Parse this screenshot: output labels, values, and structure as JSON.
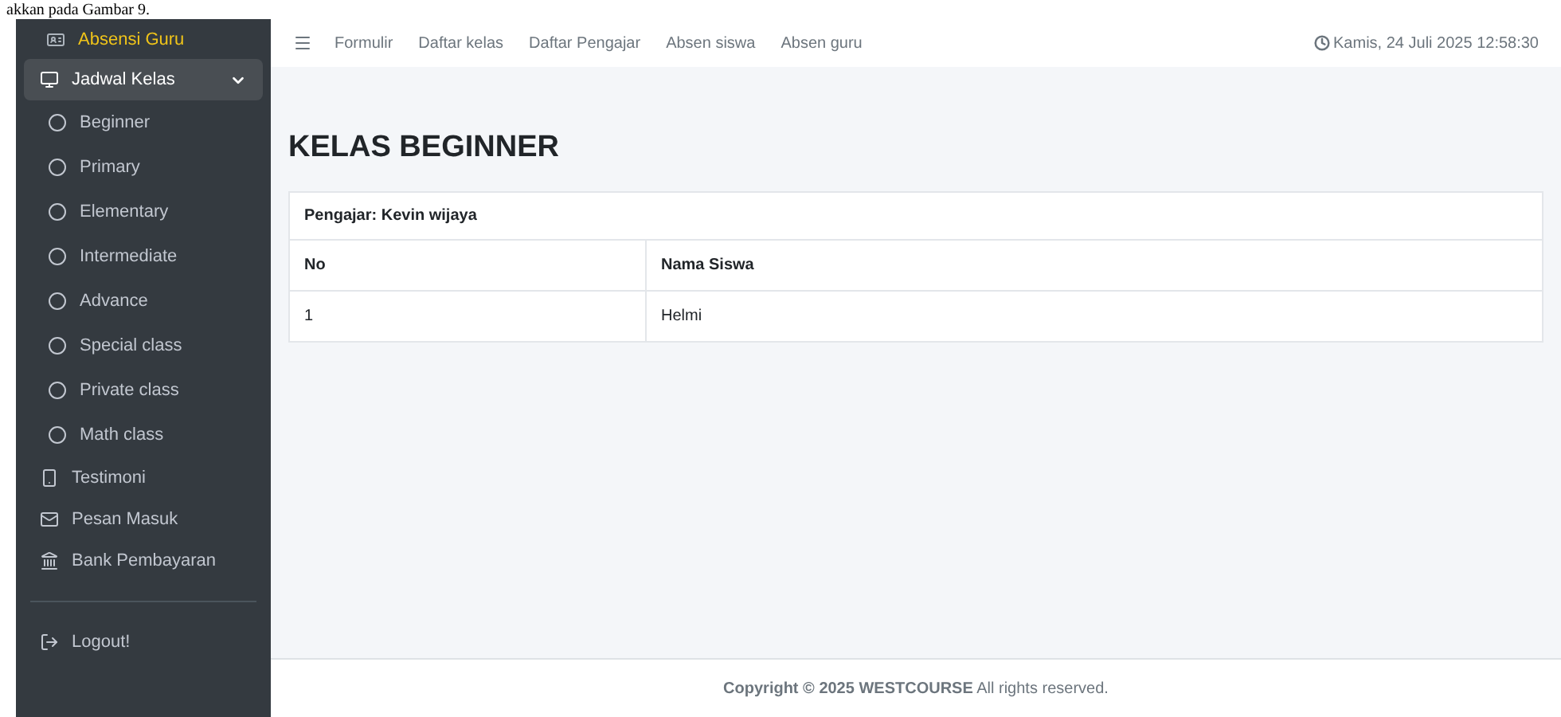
{
  "document_caption": "akkan pada Gambar 9.",
  "sidebar": {
    "brand": "Absensi Guru",
    "items": [
      {
        "kind": "menu",
        "label": "Jadwal Kelas",
        "selected": true,
        "expanded": true,
        "children": [
          {
            "label": "Beginner"
          },
          {
            "label": "Primary"
          },
          {
            "label": "Elementary"
          },
          {
            "label": "Intermediate"
          },
          {
            "label": "Advance"
          },
          {
            "label": "Special class"
          },
          {
            "label": "Private class"
          },
          {
            "label": "Math class"
          }
        ]
      },
      {
        "kind": "link",
        "label": "Testimoni",
        "selected": false
      },
      {
        "kind": "link",
        "label": "Pesan Masuk",
        "selected": false
      },
      {
        "kind": "link",
        "label": "Bank Pembayaran",
        "selected": false
      },
      {
        "kind": "divider"
      },
      {
        "kind": "link",
        "label": "Logout!",
        "selected": false
      }
    ]
  },
  "navbar": {
    "links": [
      "Formulir",
      "Daftar kelas",
      "Daftar Pengajar",
      "Absen siswa",
      "Absen guru"
    ],
    "datetime": "Kamis, 24 Juli 2025 12:58:30"
  },
  "page": {
    "title": "KELAS BEGINNER",
    "card_header": "Pengajar: Kevin wijaya",
    "table": {
      "columns": [
        "No",
        "Nama Siswa"
      ],
      "rows": [
        [
          "1",
          "Helmi"
        ]
      ]
    }
  },
  "footer": "**Copyright © 2025 WESTCOURSE** All rights reserved."
}
